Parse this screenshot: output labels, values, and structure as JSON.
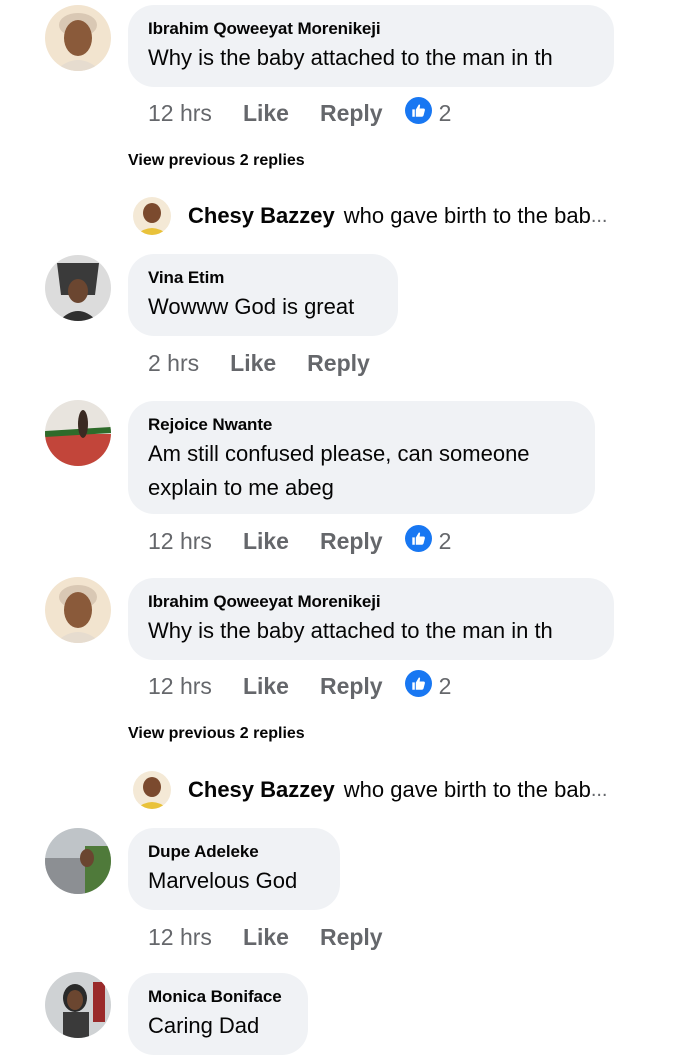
{
  "comments": [
    {
      "author": "Ibrahim Qoweeyat Morenikeji",
      "text": "Why is the baby attached to the man in th",
      "time": "12 hrs",
      "like": "Like",
      "reply": "Reply",
      "likes": "2"
    },
    {
      "author": "Vina Etim",
      "text": "Wowww God is great",
      "time": "2 hrs",
      "like": "Like",
      "reply": "Reply"
    },
    {
      "author": "Rejoice Nwante",
      "text_line1": "Am still confused please, can someone",
      "text_line2": "explain to me abeg",
      "time": "12 hrs",
      "like": "Like",
      "reply": "Reply",
      "likes": "2"
    },
    {
      "author": "Ibrahim Qoweeyat Morenikeji",
      "text": "Why is the baby attached to the man in th",
      "time": "12 hrs",
      "like": "Like",
      "reply": "Reply",
      "likes": "2"
    },
    {
      "author": "Dupe Adeleke",
      "text": "Marvelous God",
      "time": "12 hrs",
      "like": "Like",
      "reply": "Reply"
    },
    {
      "author": "Monica Boniface",
      "text": "Caring Dad"
    }
  ],
  "view_previous": "View previous 2 replies",
  "reply_preview": {
    "name": "Chesy Bazzey",
    "text": "who gave birth to the bab",
    "ellipsis": "..."
  },
  "colors": {
    "like_badge": "#1877f2",
    "bubble": "#f0f2f5",
    "meta_text": "#65676b"
  }
}
